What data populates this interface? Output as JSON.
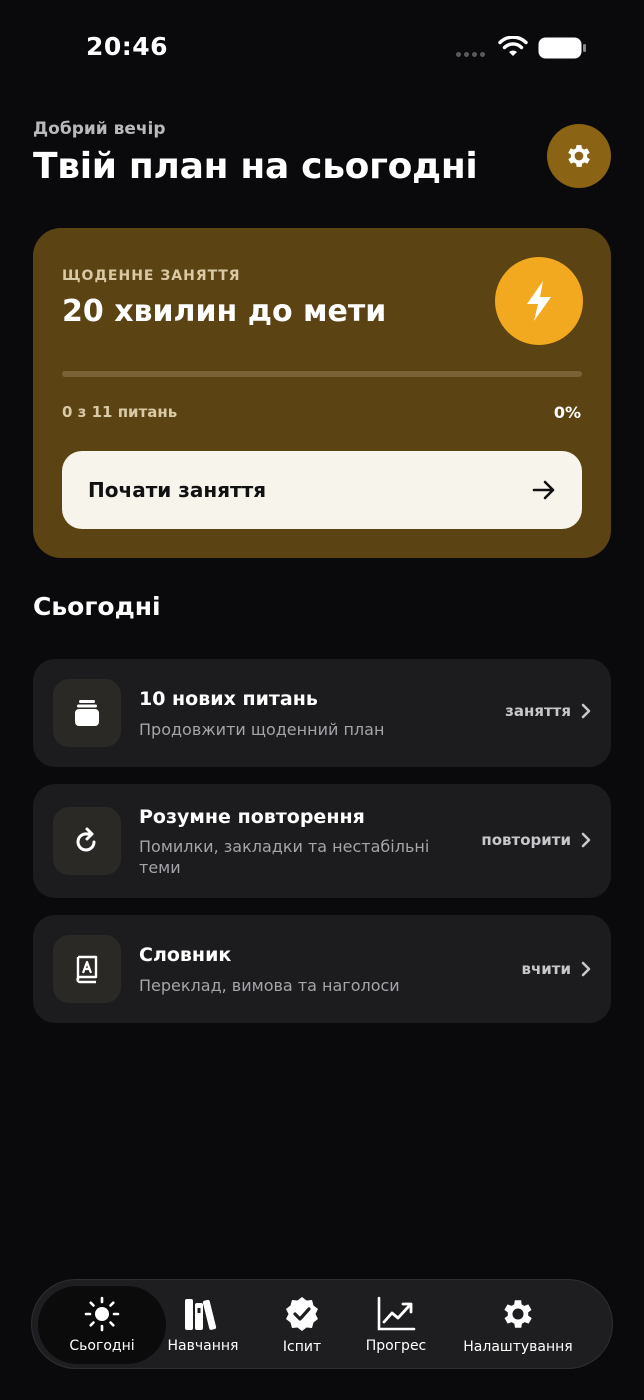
{
  "status_bar": {
    "time": "20:46"
  },
  "header": {
    "greeting": "Добрий вечір",
    "title": "Твій план на сьогодні",
    "settings_icon": "gear-icon"
  },
  "daily_card": {
    "label": "ЩОДЕННЕ ЗАНЯТТЯ",
    "title": "20 хвилин до мети",
    "icon": "bolt-icon",
    "progress_fraction": 0,
    "progress_count": "0 з 11 питань",
    "progress_percent": "0%",
    "start_button_label": "Почати заняття"
  },
  "today": {
    "title": "Сьогодні",
    "items": [
      {
        "title": "10 нових питань",
        "subtitle": "Продовжити щоденний план",
        "action": "заняття",
        "icon": "cards-stack-icon"
      },
      {
        "title": "Розумне повторення",
        "subtitle": "Помилки, закладки та нестабільні теми",
        "action": "повторити",
        "icon": "refresh-icon"
      },
      {
        "title": "Словник",
        "subtitle": "Переклад, вимова та наголоси",
        "action": "вчити",
        "icon": "dictionary-icon"
      }
    ]
  },
  "tab_bar": {
    "active": 0,
    "tabs": [
      {
        "label": "Сьогодні",
        "icon": "sun-icon"
      },
      {
        "label": "Навчання",
        "icon": "books-icon"
      },
      {
        "label": "Іспит",
        "icon": "verified-badge-icon"
      },
      {
        "label": "Прогрес",
        "icon": "chart-icon"
      },
      {
        "label": "Налаштування",
        "icon": "gear-icon"
      }
    ]
  },
  "colors": {
    "accent": "#f3a91f",
    "card_bg": "#5c4313",
    "settings_button": "#8a6414",
    "background": "#0a0a0c",
    "row_bg": "#1c1c1f"
  }
}
